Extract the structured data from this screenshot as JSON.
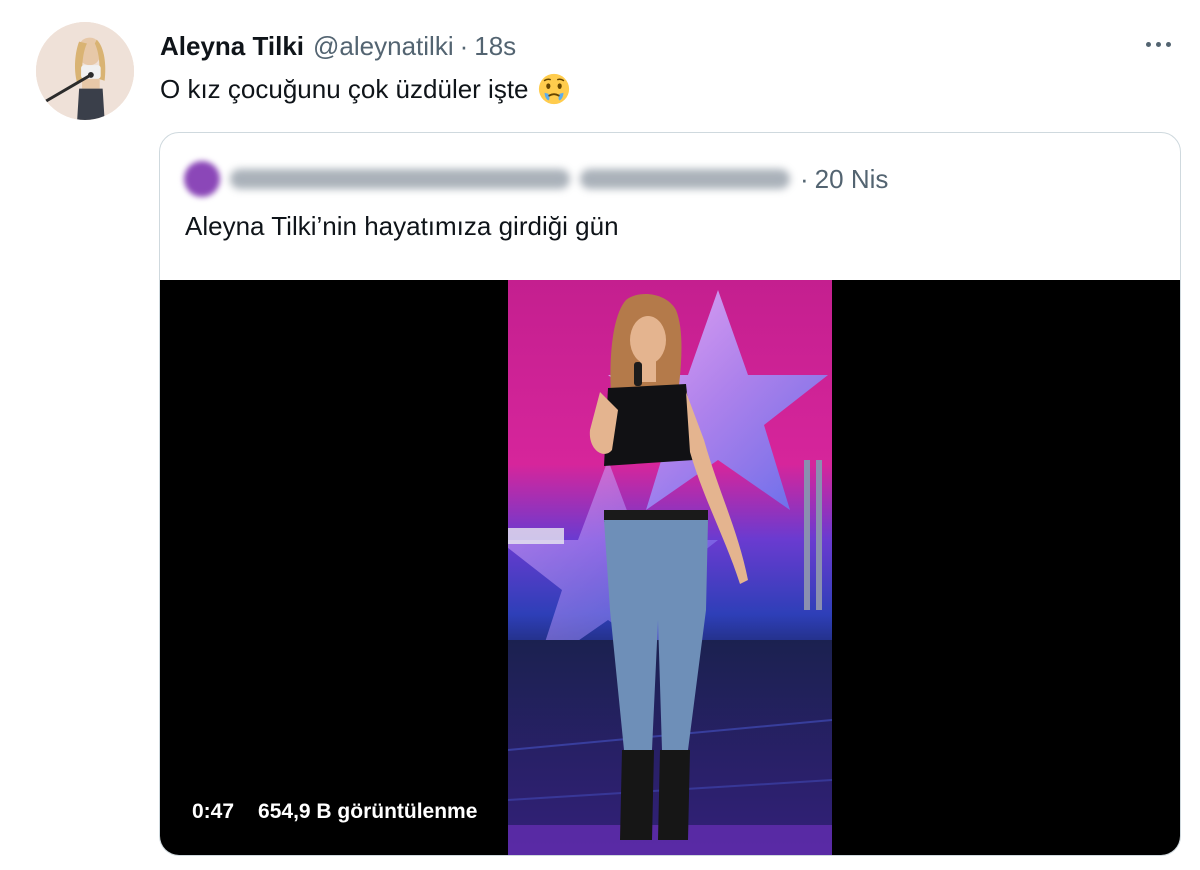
{
  "tweet": {
    "author_name": "Aleyna Tilki",
    "author_handle": "@aleynatilki",
    "separator": "·",
    "timestamp": "18s",
    "text": "O kız çocuğunu çok üzdüler işte",
    "emoji": "face-holding-back-tears"
  },
  "quoted_tweet": {
    "separator": "·",
    "timestamp": "20 Nis",
    "text": "Aleyna Tilki’nin hayatımıza girdiği gün",
    "video": {
      "duration": "0:47",
      "views": "654,9 B görüntülenme"
    }
  },
  "colors": {
    "text_primary": "#0f1419",
    "text_secondary": "#536471",
    "border": "#cfd9de",
    "video_background": "#000000",
    "stage_magenta": "#d6259b",
    "stage_blue": "#3a4fd6"
  }
}
